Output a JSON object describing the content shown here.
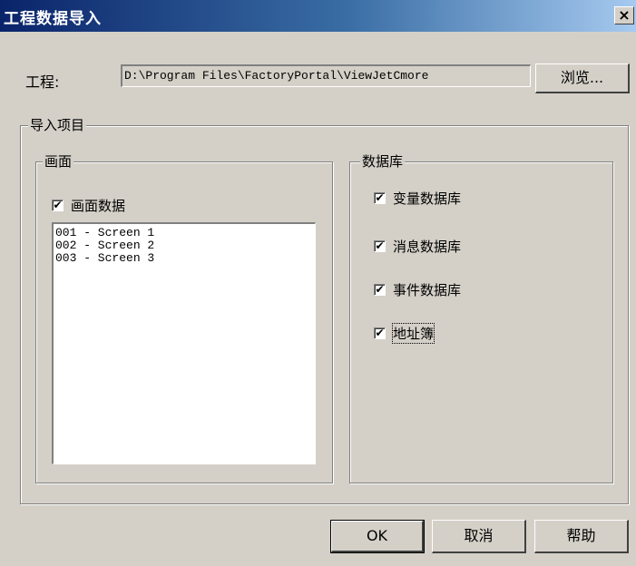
{
  "window": {
    "title": "工程数据导入",
    "close_glyph": "×"
  },
  "project": {
    "label": "工程:",
    "path": "D:\\Program Files\\FactoryPortal\\ViewJetCmore",
    "browse_label": "浏览..."
  },
  "import_group": {
    "title": "导入项目"
  },
  "screens_group": {
    "title": "画面",
    "checkbox_label": "画面数据",
    "checked": true,
    "items": [
      "001 - Screen 1",
      "002 - Screen 2",
      "003 - Screen 3"
    ]
  },
  "db_group": {
    "title": "数据库",
    "items": [
      {
        "label": "变量数据库",
        "checked": true
      },
      {
        "label": "消息数据库",
        "checked": true
      },
      {
        "label": "事件数据库",
        "checked": true
      },
      {
        "label": "地址簿",
        "checked": true,
        "focused": true
      }
    ]
  },
  "buttons": {
    "ok": "OK",
    "cancel": "取消",
    "help": "帮助"
  },
  "check_glyph": "✔"
}
